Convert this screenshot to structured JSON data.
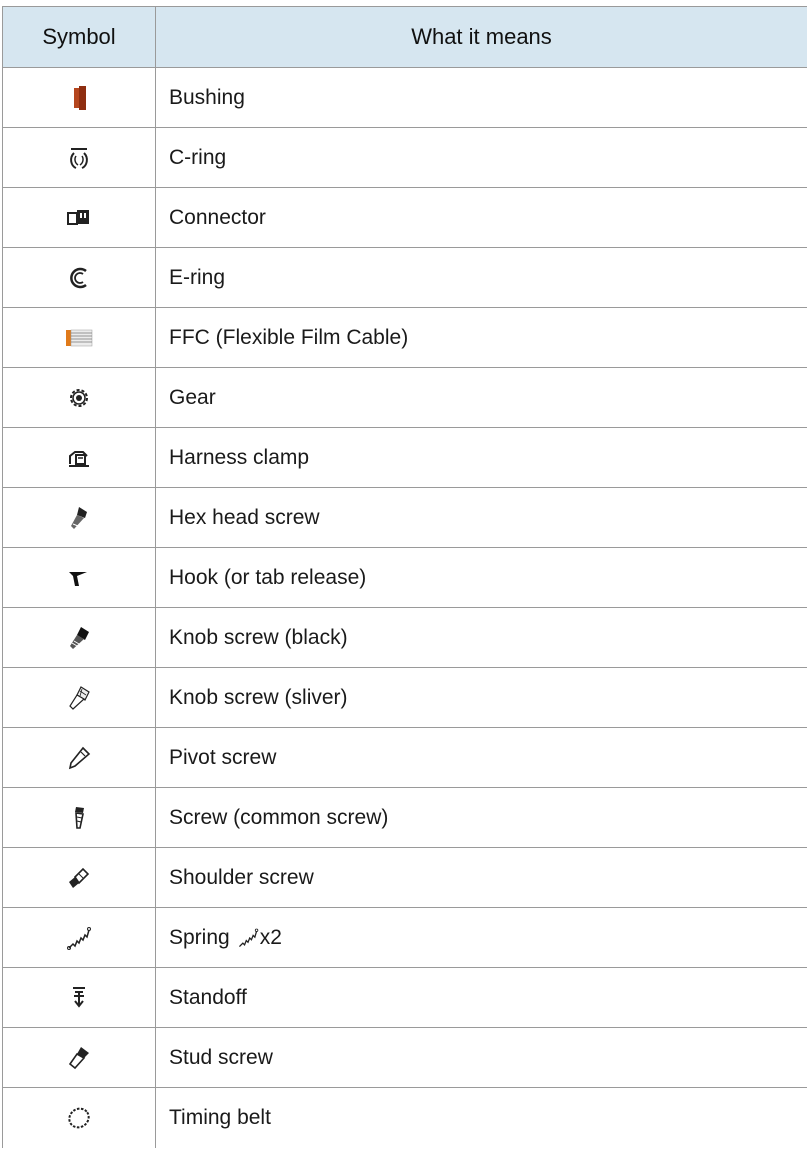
{
  "header": {
    "symbol": "Symbol",
    "meaning": "What it means"
  },
  "rows": [
    {
      "icon": "bushing-icon",
      "label": "Bushing"
    },
    {
      "icon": "c-ring-icon",
      "label": "C-ring"
    },
    {
      "icon": "connector-icon",
      "label": "Connector"
    },
    {
      "icon": "e-ring-icon",
      "label": "E-ring"
    },
    {
      "icon": "ffc-icon",
      "label": "FFC (Flexible Film Cable)"
    },
    {
      "icon": "gear-icon",
      "label": "Gear"
    },
    {
      "icon": "harness-clamp-icon",
      "label": "Harness clamp"
    },
    {
      "icon": "hex-head-screw-icon",
      "label": "Hex head screw"
    },
    {
      "icon": "hook-icon",
      "label": "Hook (or tab release)"
    },
    {
      "icon": "knob-screw-black-icon",
      "label": "Knob screw (black)"
    },
    {
      "icon": "knob-screw-silver-icon",
      "label": "Knob screw (sliver)"
    },
    {
      "icon": "pivot-screw-icon",
      "label": "Pivot screw"
    },
    {
      "icon": "screw-icon",
      "label": "Screw (common screw)"
    },
    {
      "icon": "shoulder-screw-icon",
      "label": "Shoulder screw"
    },
    {
      "icon": "spring-icon",
      "label": "Spring",
      "suffix": "x2"
    },
    {
      "icon": "standoff-icon",
      "label": "Standoff"
    },
    {
      "icon": "stud-screw-icon",
      "label": "Stud screw"
    },
    {
      "icon": "timing-belt-icon",
      "label": "Timing belt"
    }
  ]
}
